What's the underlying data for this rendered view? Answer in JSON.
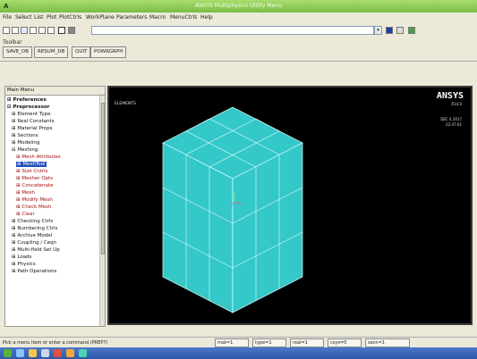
{
  "window": {
    "title": "ANSYS Multiphysics Utility Menu",
    "system_icon": "A"
  },
  "menubar": [
    "File",
    "Select",
    "List",
    "Plot",
    "PlotCtrls",
    "WorkPlane",
    "Parameters",
    "Macro",
    "MenuCtrls",
    "Help"
  ],
  "command": {
    "value": "",
    "dropdown_icon": "chevron-down-icon"
  },
  "toolbar": {
    "label": "Toolbar",
    "buttons": [
      "SAVE_DB",
      "RESUM_DB",
      "QUIT",
      "POWRGRPH"
    ]
  },
  "main_menu": {
    "header": "Main Menu",
    "items": [
      "⊞ Preferences",
      "⊟ Preprocessor",
      "⊞ Element Type",
      "⊞ Real Constants",
      "⊞ Material Props",
      "⊞ Sections",
      "⊞ Modeling",
      "⊟ Meshing",
      "⊞ Mesh Attributes",
      "⊞ MeshTool",
      "⊞ Size Cntrls",
      "⊞ Mesher Opts",
      "⊞ Concatenate",
      "⊞ Mesh",
      "⊞ Modify Mesh",
      "⊞ Check Mesh",
      "⊞ Clear",
      "⊞ Checking Ctrls",
      "⊞ Numbering Ctrls",
      "⊞ Archive Model",
      "⊞ Coupling / Ceqn",
      "⊞ Multi-field Set Up",
      "⊞ Loads",
      "⊞ Physics",
      "⊞ Path Operations"
    ]
  },
  "graphics": {
    "element_label": "ELEMENTS",
    "brand": "ANSYS",
    "version": "R14.0",
    "date": "DEC 4 2017",
    "time": "22:47:01",
    "mesh_color": "#34c8c8",
    "background": "#000000"
  },
  "status": {
    "prompt": "Pick a menu item or enter a command (PREP7)",
    "fields": [
      "mat=1",
      "type=1",
      "real=1",
      "csys=0",
      "secn=1"
    ]
  },
  "colors": {
    "titlebar": "#8fcc57",
    "taskbar": "#3a66b8",
    "selected": "#2050b8",
    "red_item": "#a31010"
  }
}
